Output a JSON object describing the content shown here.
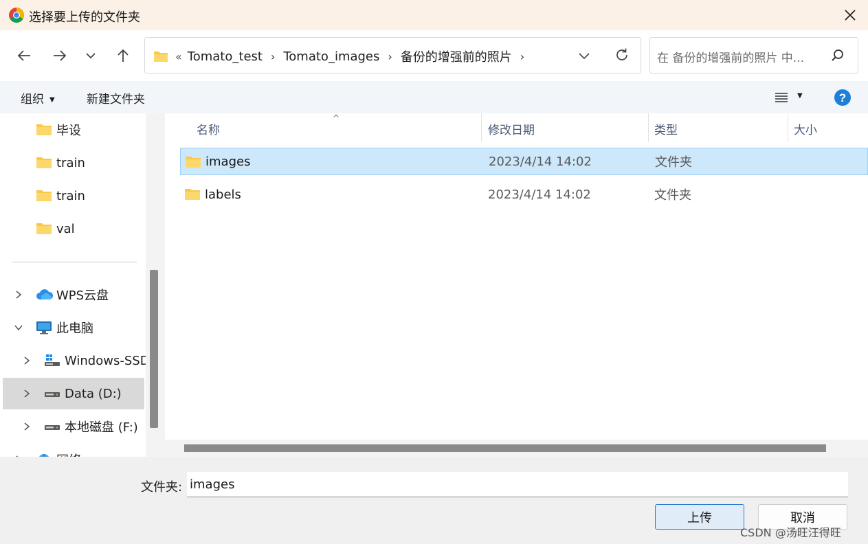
{
  "window": {
    "title": "选择要上传的文件夹"
  },
  "breadcrumb": {
    "lead": "«",
    "items": [
      "Tomato_test",
      "Tomato_images",
      "备份的增强前的照片"
    ]
  },
  "search": {
    "placeholder": "在 备份的增强前的照片 中..."
  },
  "commandbar": {
    "organize": "组织",
    "new_folder": "新建文件夹"
  },
  "nav": {
    "items": [
      {
        "label": "毕设",
        "icon": "folder-icon"
      },
      {
        "label": "train",
        "icon": "folder-icon"
      },
      {
        "label": "train",
        "icon": "folder-icon"
      },
      {
        "label": "val",
        "icon": "folder-icon"
      },
      {
        "label": "WPS云盘",
        "icon": "cloud-icon"
      },
      {
        "label": "此电脑",
        "icon": "computer-icon"
      },
      {
        "label": "Windows-SSD",
        "icon": "windows-drive-icon"
      },
      {
        "label": "Data (D:)",
        "icon": "drive-icon",
        "selected": true
      },
      {
        "label": "本地磁盘 (F:)",
        "icon": "drive-icon"
      },
      {
        "label": "网络",
        "icon": "network-icon"
      }
    ]
  },
  "columns": {
    "name": "名称",
    "modified": "修改日期",
    "type": "类型",
    "size": "大小"
  },
  "files": [
    {
      "name": "images",
      "modified": "2023/4/14 14:02",
      "type": "文件夹",
      "selected": true
    },
    {
      "name": "labels",
      "modified": "2023/4/14 14:02",
      "type": "文件夹"
    }
  ],
  "bottom": {
    "folder_label": "文件夹:",
    "folder_value": "images",
    "upload_label": "上传",
    "cancel_label": "取消"
  },
  "watermark": "CSDN @汤旺汪得旺",
  "colors": {
    "title_bar": "#fbf1e6",
    "selection": "#cde8fb",
    "accent": "#2b7ad4"
  }
}
